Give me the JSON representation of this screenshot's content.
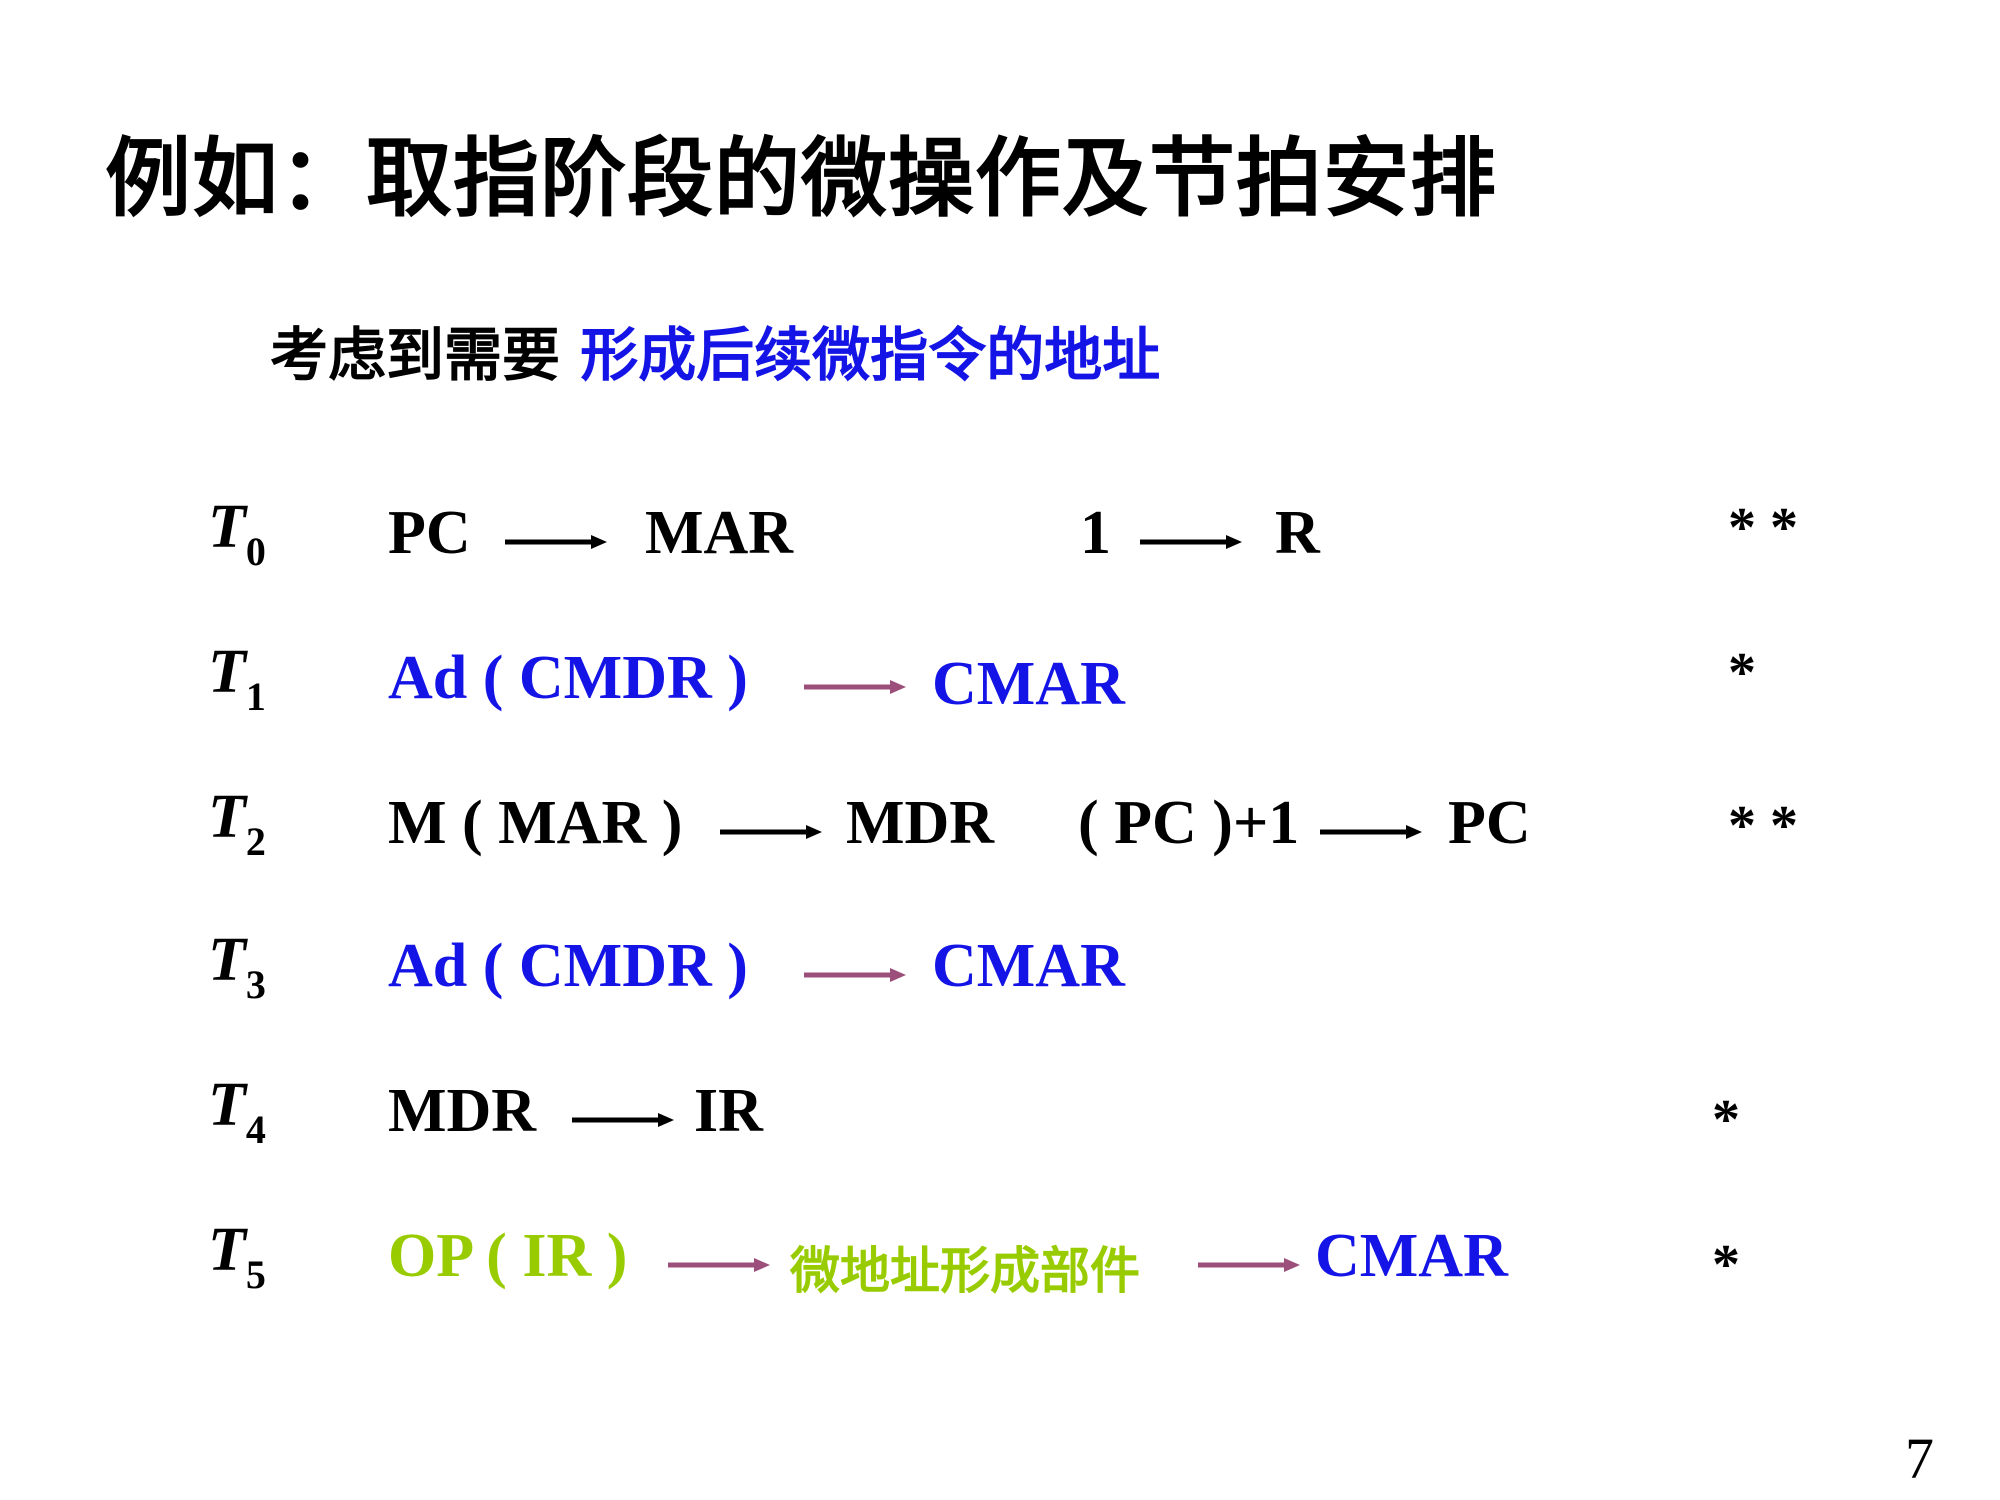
{
  "title": "例如：取指阶段的微操作及节拍安排",
  "subtitle": {
    "prefix": "考虑到需要 ",
    "highlight": "形成后续微指令的地址"
  },
  "rows": [
    {
      "t": "T",
      "sub": "0",
      "a": "PC",
      "b": "MAR",
      "c": "1",
      "d": "R",
      "stars": "* *"
    },
    {
      "t": "T",
      "sub": "1",
      "a": "Ad ( CMDR )",
      "b": "CMAR",
      "stars": "*"
    },
    {
      "t": "T",
      "sub": "2",
      "a": "M ( MAR )",
      "b": "MDR",
      "c": "( PC )+1",
      "d": "PC",
      "stars": "* *"
    },
    {
      "t": "T",
      "sub": "3",
      "a": "Ad ( CMDR )",
      "b": "CMAR"
    },
    {
      "t": "T",
      "sub": "4",
      "a": "MDR",
      "b": "IR",
      "stars": "*"
    },
    {
      "t": "T",
      "sub": "5",
      "a": "OP ( IR )",
      "b": "微地址形成部件",
      "c": "CMAR",
      "stars": "*"
    }
  ],
  "page_number": "7",
  "colors": {
    "blue": "#1414e6",
    "green": "#99cc00",
    "arrow_purple": "#9c4f7a",
    "black": "#000000"
  },
  "icons": [
    "arrow-right-icon"
  ]
}
